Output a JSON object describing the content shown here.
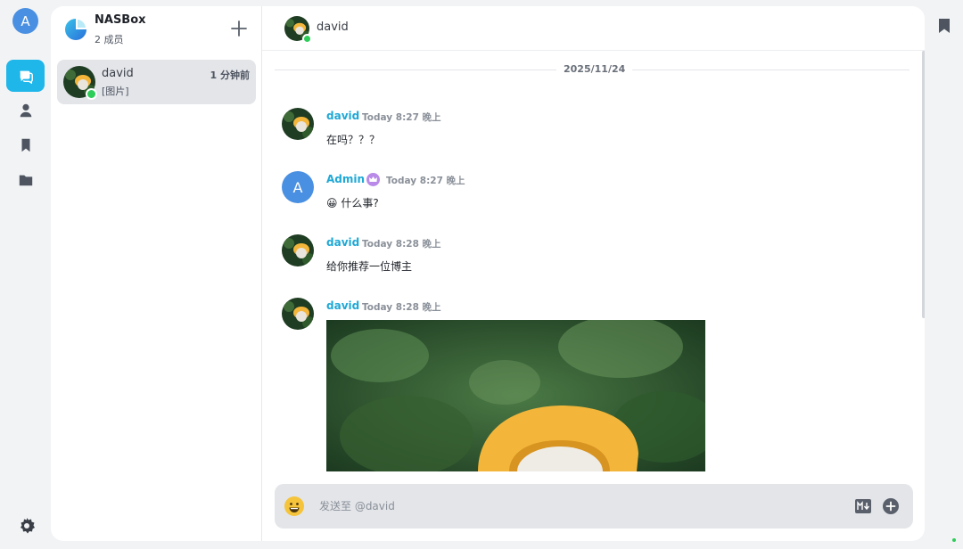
{
  "rail": {
    "user_initial": "A",
    "items": [
      {
        "icon": "chat-bubbles-icon",
        "active": true
      },
      {
        "icon": "user-icon",
        "active": false
      },
      {
        "icon": "bookmark-icon",
        "active": false
      },
      {
        "icon": "folder-icon",
        "active": false
      }
    ],
    "settings_icon": "gear-icon"
  },
  "group": {
    "name": "NASBox",
    "members": "2 成员",
    "add_icon": "plus-icon"
  },
  "conversations": [
    {
      "name": "david",
      "time": "1 分钟前",
      "preview": "[图片]",
      "online": true
    }
  ],
  "chat": {
    "peer_name": "david",
    "date": "2025/11/24",
    "messages": [
      {
        "sender": "david",
        "time": "Today 8:27 晚上",
        "text": "在吗？？？",
        "avatar": "photo"
      },
      {
        "sender": "Admin",
        "time": "Today 8:27 晚上",
        "text": "😀 什么事?",
        "avatar": "A",
        "badge": "crown-icon"
      },
      {
        "sender": "david",
        "time": "Today 8:28 晚上",
        "text": "给你推荐一位博主",
        "avatar": "photo"
      },
      {
        "sender": "david",
        "time": "Today 8:28 晚上",
        "image": "duck-with-yellow-hat-photo",
        "avatar": "photo"
      }
    ]
  },
  "composer": {
    "placeholder": "发送至 @david",
    "value": "",
    "emoji_icon": "emoji-smile-icon",
    "markdown_icon": "markdown-icon",
    "attach_icon": "plus-circle-icon"
  },
  "colors": {
    "accent": "#1fb6ea",
    "name": "#1fa8d6",
    "online": "#2ecc59",
    "avatar_letter_bg": "#4a90e2"
  }
}
